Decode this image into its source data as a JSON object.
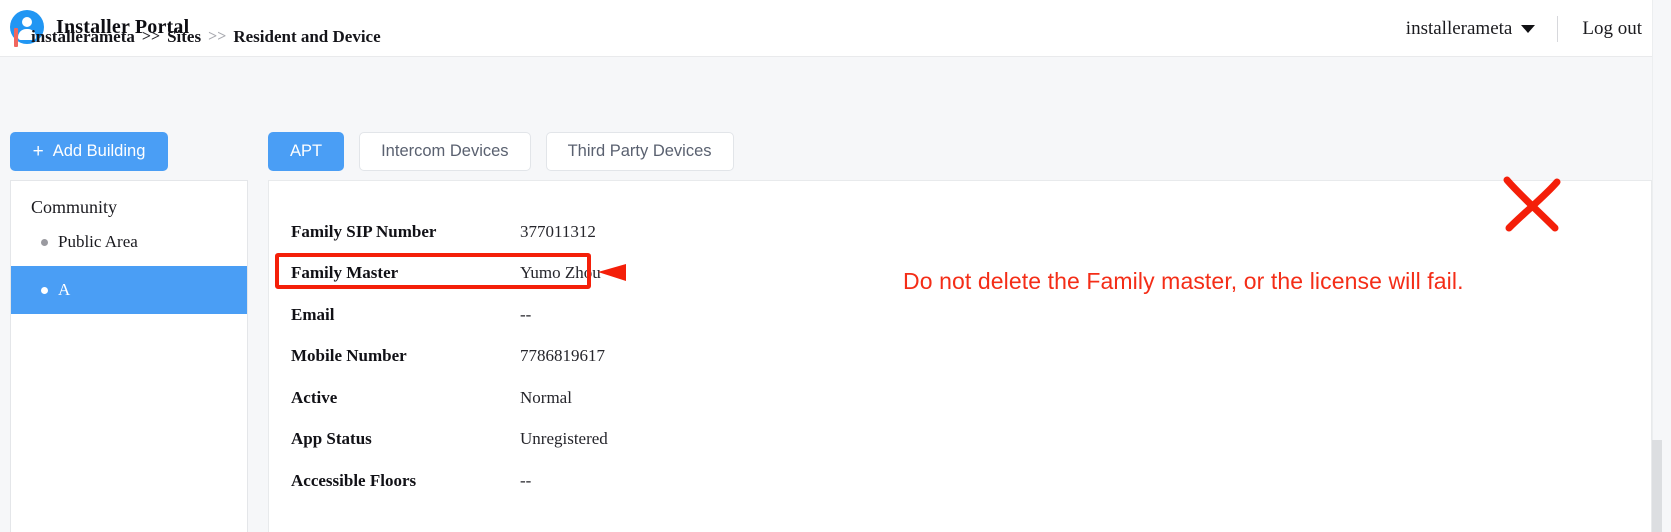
{
  "header": {
    "avatar_icon": "user-avatar-icon",
    "title": "Installer Portal",
    "username": "installerameta",
    "caret_icon": "chevron-down-icon",
    "logout_label": "Log out"
  },
  "breadcrumb": {
    "items": [
      "installerameta",
      "Sites",
      "Resident and Device"
    ],
    "separator": ">>"
  },
  "toolbar": {
    "add_building_label": "Add Building",
    "add_building_plus": "+"
  },
  "sidebar": {
    "root_label": "Community",
    "items": [
      {
        "label": "Public Area",
        "active": false
      },
      {
        "label": "A",
        "active": true
      }
    ]
  },
  "tabs": [
    {
      "label": "APT",
      "active": true
    },
    {
      "label": "Intercom Devices",
      "active": false
    },
    {
      "label": "Third Party Devices",
      "active": false
    }
  ],
  "details": {
    "rows": [
      {
        "label": "Family SIP Number",
        "value": "377011312"
      },
      {
        "label": "Family Master",
        "value": "Yumo Zhou"
      },
      {
        "label": "Email",
        "value": "--"
      },
      {
        "label": "Mobile Number",
        "value": "7786819617"
      },
      {
        "label": "Active",
        "value": "Normal"
      },
      {
        "label": "App Status",
        "value": "Unregistered"
      },
      {
        "label": "Accessible Floors",
        "value": "--"
      }
    ]
  },
  "annotations": {
    "warning_text": "Do not delete the Family master, or the license will fail.",
    "highlight_color": "#f41f09",
    "arrow_icon": "left-arrow-annotation",
    "cross_icon": "red-cross-annotation",
    "delete_icon": "trash-icon"
  },
  "colors": {
    "accent": "#4a9ef5",
    "annotation_red": "#f42d17",
    "page_background": "#f6f7f9"
  }
}
